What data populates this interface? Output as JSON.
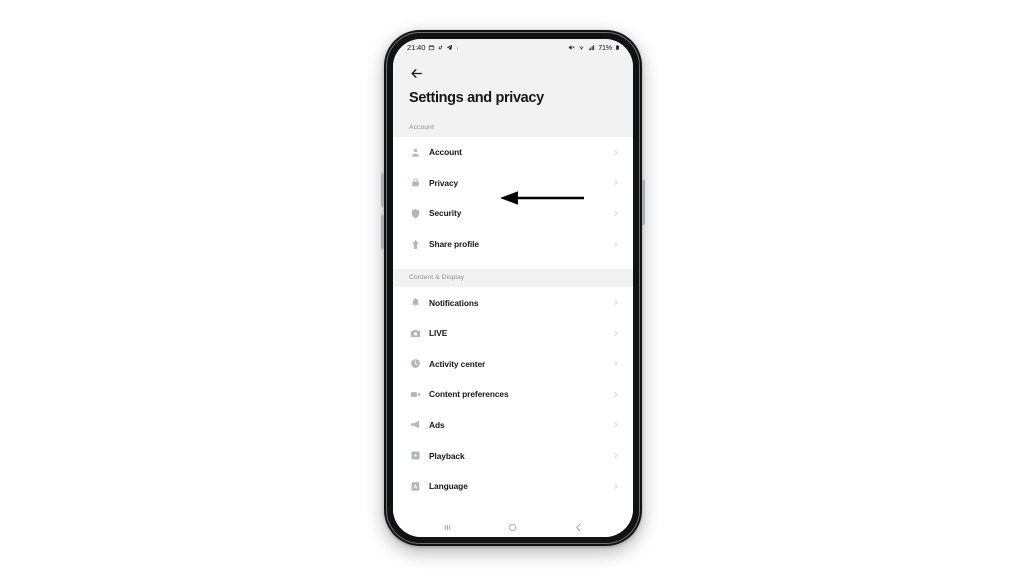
{
  "status_bar": {
    "time": "21:40",
    "left_icons": [
      "calendar-icon",
      "tiktok-note-icon",
      "telegram-icon",
      "dot-icon"
    ],
    "right_icons": [
      "mute-icon",
      "wifi-icon",
      "signal-icon"
    ],
    "battery_percent": "71%",
    "battery_icon": "battery-icon"
  },
  "header": {
    "back_icon": "back-arrow-icon",
    "title": "Settings and privacy"
  },
  "sections": [
    {
      "label": "Account",
      "items": [
        {
          "label": "Account",
          "icon": "person-icon"
        },
        {
          "label": "Privacy",
          "icon": "lock-icon"
        },
        {
          "label": "Security",
          "icon": "shield-icon"
        },
        {
          "label": "Share profile",
          "icon": "share-arrow-icon"
        }
      ]
    },
    {
      "label": "Content & Display",
      "items": [
        {
          "label": "Notifications",
          "icon": "bell-icon"
        },
        {
          "label": "LIVE",
          "icon": "camera-icon"
        },
        {
          "label": "Activity center",
          "icon": "clock-icon"
        },
        {
          "label": "Content preferences",
          "icon": "video-camera-icon"
        },
        {
          "label": "Ads",
          "icon": "megaphone-icon"
        },
        {
          "label": "Playback",
          "icon": "playback-icon"
        },
        {
          "label": "Language",
          "icon": "language-icon"
        }
      ]
    }
  ],
  "nav_bar": {
    "recents_icon": "recents-icon",
    "home_icon": "home-icon",
    "back_icon": "nav-back-icon"
  },
  "annotation": {
    "type": "left-pointing-arrow",
    "points_at": "Privacy",
    "color": "#000000"
  },
  "colors": {
    "screen_background": "#ffffff",
    "header_background": "#f2f2f2",
    "text_primary": "#16181c",
    "text_muted": "#8d9196",
    "icon_gray": "#b3b6ba",
    "chevron_gray": "#d2d4d7",
    "phone_frame": "#111214"
  }
}
